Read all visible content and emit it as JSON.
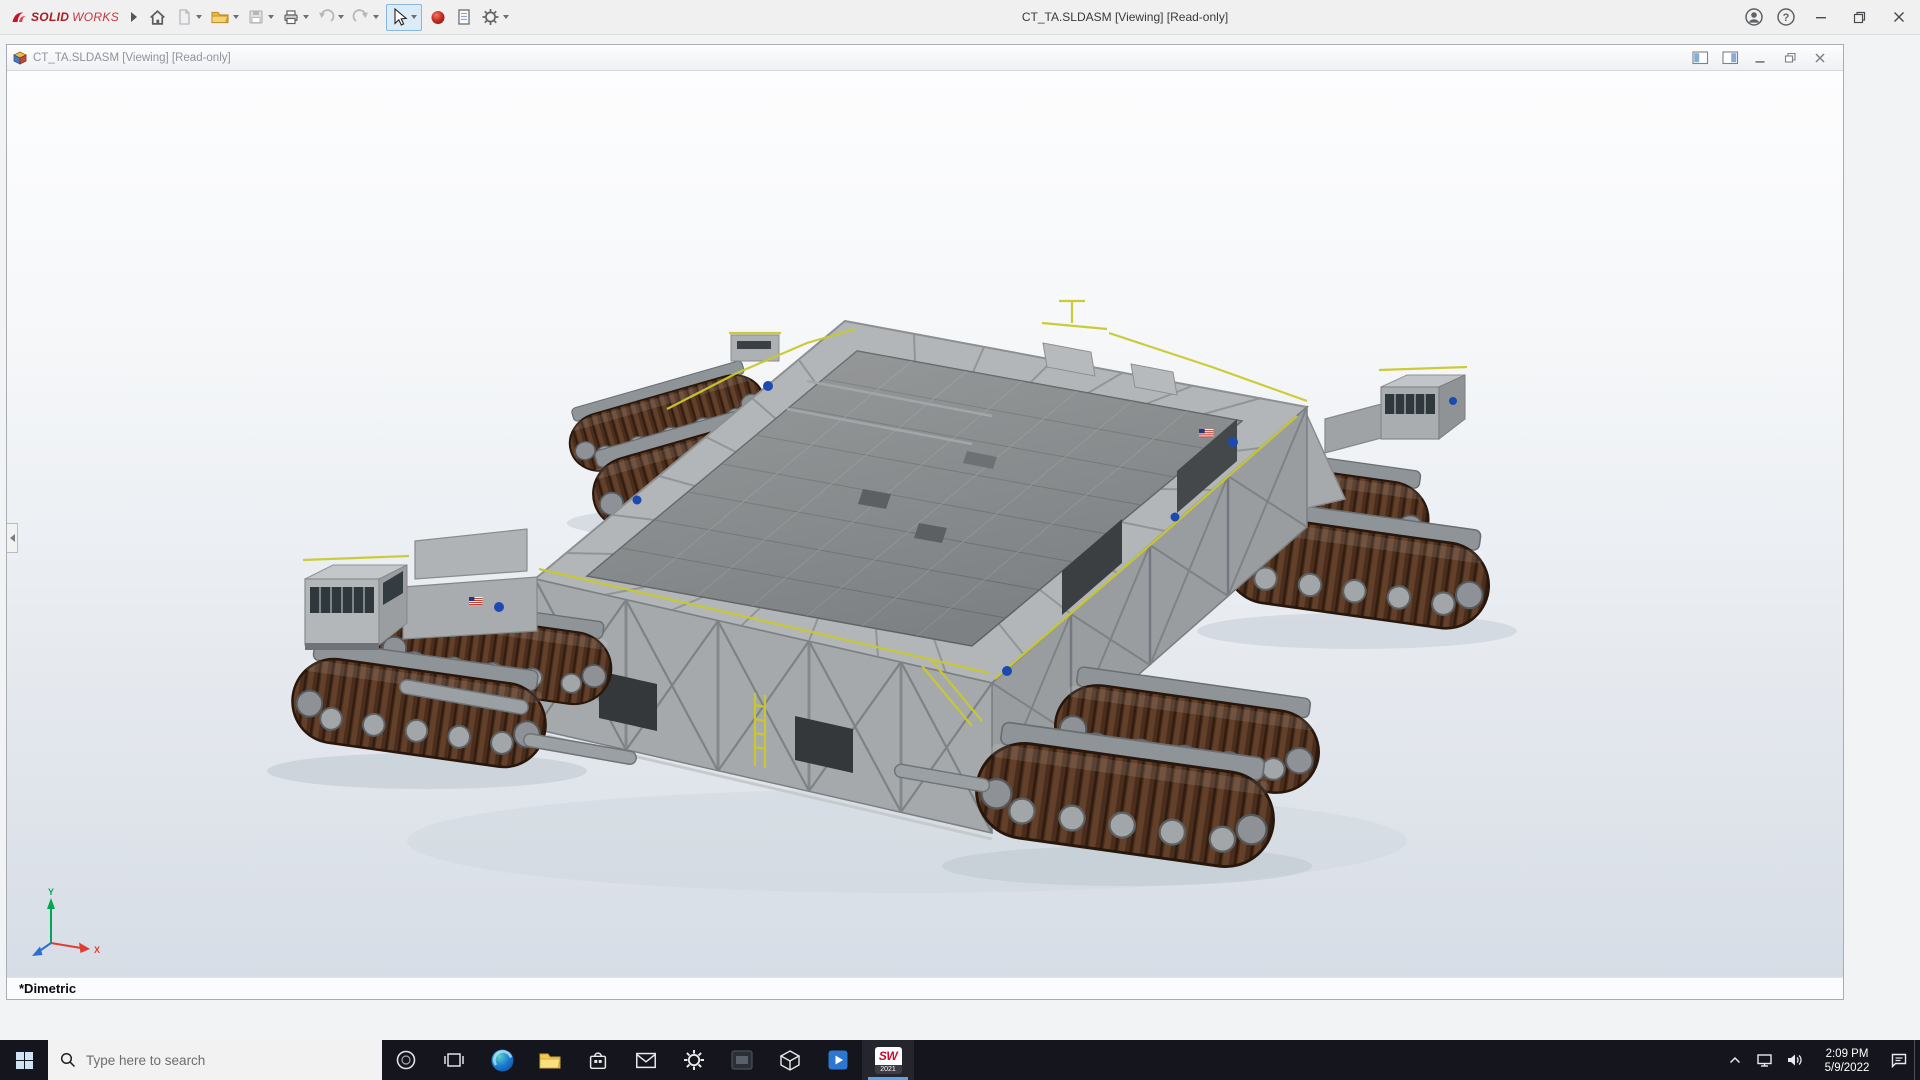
{
  "app": {
    "title": "CT_TA.SLDASM [Viewing] [Read-only]",
    "brand": {
      "bold": "SOLID",
      "light": "WORKS"
    },
    "help_glyph": "?",
    "toolbar_items": [
      "home",
      "new-document",
      "open",
      "save",
      "print",
      "undo",
      "redo",
      "select",
      "3dexperience",
      "document-properties",
      "options"
    ]
  },
  "document": {
    "title": "CT_TA.SLDASM [Viewing] [Read-only]",
    "view_orientation": "*Dimetric",
    "triad": {
      "x_label": "X",
      "y_label": "Y"
    }
  },
  "taskbar": {
    "search": {
      "placeholder": "Type here to search"
    },
    "apps": [
      "start",
      "search",
      "cortana",
      "task-view",
      "edge",
      "file-explorer",
      "store",
      "mail",
      "settings",
      "screen-capture",
      "3d-viewer",
      "media-player",
      "solidworks-2021"
    ],
    "solidworks": {
      "text": "SW",
      "year": "2021"
    },
    "tray": {
      "time": "2:09 PM",
      "date": "5/9/2022"
    }
  },
  "colors": {
    "taskbar_bg": "#15151e",
    "selection_blue": "#86b8e0",
    "viewport_top": "#fdfdfe",
    "viewport_bottom": "#d7dde6",
    "deck_gray": "#7e8183",
    "frame_gray": "#b3b6b8",
    "track_brown": "#4a2d1c",
    "railing_yellow": "#c9c92e",
    "nasa_blue": "#1d4ab0",
    "triad_x_red": "#e03c31",
    "triad_y_green": "#00a651",
    "triad_z_blue": "#2b6fd4",
    "brand_red": "#c8102e"
  }
}
